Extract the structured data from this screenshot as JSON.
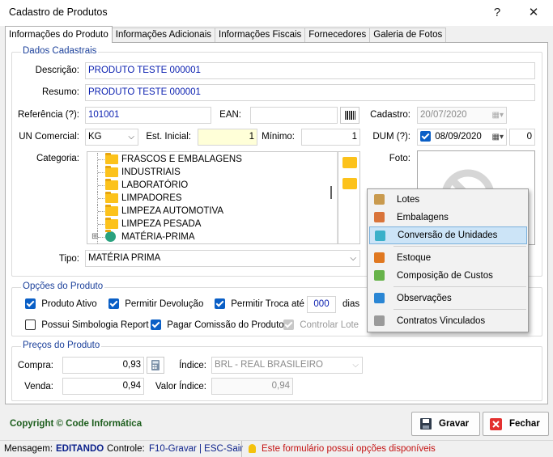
{
  "window": {
    "title": "Cadastro de Produtos",
    "help": "?",
    "close": "✕"
  },
  "tabs": [
    {
      "label": "Informações do Produto",
      "active": true
    },
    {
      "label": "Informações Adicionais"
    },
    {
      "label": "Informações Fiscais"
    },
    {
      "label": "Fornecedores"
    },
    {
      "label": "Galeria de Fotos"
    }
  ],
  "dados": {
    "group_title": "Dados Cadastrais",
    "descricao_label": "Descrição:",
    "descricao_value": "PRODUTO TESTE 000001",
    "resumo_label": "Resumo:",
    "resumo_value": "PRODUTO TESTE 000001",
    "referencia_label": "Referência (?):",
    "referencia_value": "101001",
    "ean_label": "EAN:",
    "ean_value": "",
    "cadastro_label": "Cadastro:",
    "cadastro_value": "20/07/2020",
    "un_label": "UN Comercial:",
    "un_value": "KG",
    "est_inicial_label": "Est. Inicial:",
    "est_inicial_value": "1",
    "minimo_label": "Mínimo:",
    "minimo_value": "1",
    "dum_label": "DUM (?):",
    "dum_value": "08/09/2020",
    "dum_extra": "0",
    "categoria_label": "Categoria:",
    "foto_label": "Foto:",
    "tipo_label": "Tipo:",
    "tipo_value": "MATÉRIA PRIMA"
  },
  "categorias": [
    "FRASCOS E EMBALAGENS",
    "INDUSTRIAIS",
    "LABORATÓRIO",
    "LIMPADORES",
    "LIMPEZA AUTOMOTIVA",
    "LIMPEZA PESADA",
    "MATÉRIA-PRIMA"
  ],
  "context_menu": [
    {
      "label": "Lotes",
      "icon": "lotes-icon",
      "color": "#c99a4e"
    },
    {
      "label": "Embalagens",
      "icon": "box-icon",
      "color": "#d9743a"
    },
    {
      "label": "Conversão de Unidades",
      "icon": "conversion-icon",
      "color": "#3ab0c9",
      "highlighted": true
    },
    {
      "label": "Estoque",
      "icon": "stock-icon",
      "color": "#e07820"
    },
    {
      "label": "Composição de Custos",
      "icon": "money-icon",
      "color": "#67b34a"
    },
    {
      "label": "Observações",
      "icon": "notes-icon",
      "color": "#2a86d4"
    },
    {
      "label": "Contratos Vinculados",
      "icon": "contract-icon",
      "color": "#9a9a9a"
    }
  ],
  "opcoes": {
    "group_title": "Opções do Produto",
    "produto_ativo": "Produto Ativo",
    "permitir_devolucao": "Permitir Devolução",
    "permitir_troca": "Permitir Troca até",
    "troca_dias_value": "000",
    "dias": "dias",
    "simbologia": "Possui Simbologia Report",
    "comissao": "Pagar Comissão do Produto",
    "controlar_lote": "Controlar Lote"
  },
  "precos": {
    "group_title": "Preços do Produto",
    "compra_label": "Compra:",
    "compra_value": "0,93",
    "venda_label": "Venda:",
    "venda_value": "0,94",
    "indice_label": "Índice:",
    "indice_value": "BRL - REAL BRASILEIRO",
    "valor_indice_label": "Valor Índice:",
    "valor_indice_value": "0,94"
  },
  "footer": {
    "copyright": "Copyright © Code Informática",
    "gravar": "Gravar",
    "fechar": "Fechar"
  },
  "status": {
    "mensagem_label": "Mensagem:",
    "mensagem_value": "EDITANDO",
    "controle_label": "Controle:",
    "controle_value": "F10-Gravar | ESC-Sair",
    "info": "Este formulário possui opções disponíveis"
  }
}
